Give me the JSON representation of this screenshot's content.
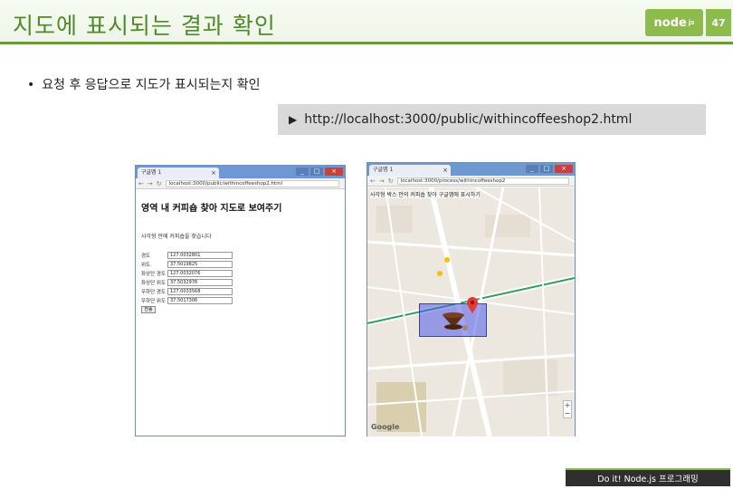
{
  "slide": {
    "title": "지도에 표시되는 결과 확인",
    "logo_text": "node",
    "logo_suffix": "js",
    "page_number": "47",
    "bullet_mark": "•",
    "bullet_text": "요청 후 응답으로 지도가 표시되는지 확인",
    "url_arrow": "▶",
    "url": "http://localhost:3000/public/withincoffeeshop2.html",
    "footer": "Do it! Node.js 프로그래밍"
  },
  "left_browser": {
    "tab_label": "구글맵 1",
    "tab_close": "×",
    "address": "localhost:3000/public/withincoffeeshop2.html",
    "page_title": "영역 내 커피숍 찾아 지도로 보여주기",
    "message": "사각형 안에 커피숍을 찾습니다",
    "fields": [
      {
        "label": "경도",
        "value": "127.0032801"
      },
      {
        "label": "위도",
        "value": "37.5019825"
      },
      {
        "label": "좌상단 경도",
        "value": "127.0032076"
      },
      {
        "label": "좌상단 위도",
        "value": "37.5032976"
      },
      {
        "label": "우하단 경도",
        "value": "127.0033568"
      },
      {
        "label": "우하단 위도",
        "value": "37.5017306"
      }
    ],
    "submit_label": "전송"
  },
  "right_browser": {
    "tab_label": "구글맵 1",
    "tab_close": "×",
    "address": "localhost:3000/process/withincoffeeshop2",
    "map_header": "사각형 박스 안의 커피숍 찾아 구글맵에 표시하기",
    "google_label": "Google",
    "zoom_plus": "+",
    "zoom_minus": "−"
  }
}
